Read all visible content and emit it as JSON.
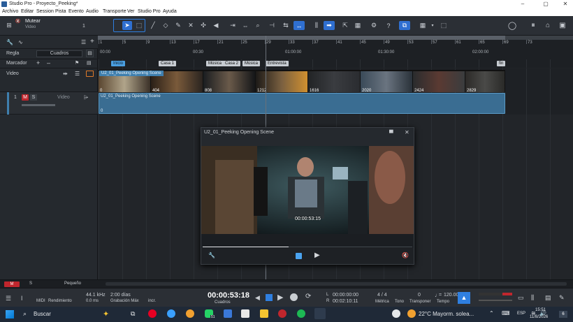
{
  "window": {
    "title": "Studio Pro - Proyecto_Peeking*"
  },
  "menu": [
    "Archivo",
    "Editar",
    "Session",
    "Pista",
    "Evento",
    "Audio",
    "Transporte",
    "Ver",
    "Studio Pro",
    "Ayuda"
  ],
  "track_header": {
    "mute_label": "Mutear",
    "mute_sub": "Video",
    "mute_count": "1",
    "ruler_label": "Regla",
    "ruler_mode": "Cuadros",
    "marker_label": "Marcador",
    "video_label": "Video",
    "track_num": "1",
    "m_label": "M",
    "s_label": "S",
    "track_type": "Video"
  },
  "ruler": {
    "bars": [
      "1",
      "5",
      "9",
      "13",
      "17",
      "21",
      "25",
      "29",
      "33",
      "37",
      "41",
      "45",
      "49",
      "53",
      "57",
      "61",
      "65",
      "69",
      "73"
    ],
    "times": [
      "00:00",
      "00:30",
      "01:00:00",
      "01:30:00",
      "02:00:00"
    ]
  },
  "markers": [
    {
      "label": "Inicio",
      "blue": true
    },
    {
      "label": "Casa 1",
      "blue": false
    },
    {
      "label": "Música",
      "blue": false
    },
    {
      "label": "Casa 2",
      "blue": false
    },
    {
      "label": "Música",
      "blue": false
    },
    {
      "label": "Entrevista",
      "blue": false
    },
    {
      "label": "fin",
      "blue": false
    }
  ],
  "video_clip": {
    "name": "U2_01_Peeking Opening Scene",
    "frames": [
      "0",
      "404",
      "808",
      "1212",
      "1616",
      "2020",
      "2424",
      "2829"
    ]
  },
  "track_clip": {
    "name": "U2_01_Peeking Opening Scene",
    "start": "0"
  },
  "player": {
    "title": "U2_01_Peeking Opening Scene",
    "timecode": "00:00:53:15",
    "progress": 0.41
  },
  "bottom": {
    "m": "M",
    "s": "S",
    "size": "Pequeño"
  },
  "transport": {
    "midi": "MIDI",
    "rend": "Rendimiento",
    "rate": "44.1 kHz",
    "lat": "0.0 ms",
    "dias": "2:00 días",
    "grab": "Grabación Máx",
    "incr": "incr.",
    "time": "00:00:53:18",
    "time_unit": "Cuadros",
    "l_label": "L",
    "r_label": "R",
    "l_time": "00:00:00:00",
    "r_time": "00:02:10:11",
    "metric": "4 / 4",
    "metric_l": "Métrica",
    "tono_l": "Tono",
    "transp_v": "0",
    "transp_l": "Transponer",
    "tempo_v": "120.00",
    "tempo_l": "Tempo"
  },
  "taskbar": {
    "search": "Buscar",
    "weather": "22°C  Mayorm. solea...",
    "lang": "ESP",
    "clock": "15:51",
    "date": "11/8/2026",
    "notif": "6",
    "whatsapp_badge": "51"
  },
  "colors": {
    "accent": "#2f6fd0",
    "mute": "#c0262d",
    "clip": "#3f7fae"
  }
}
